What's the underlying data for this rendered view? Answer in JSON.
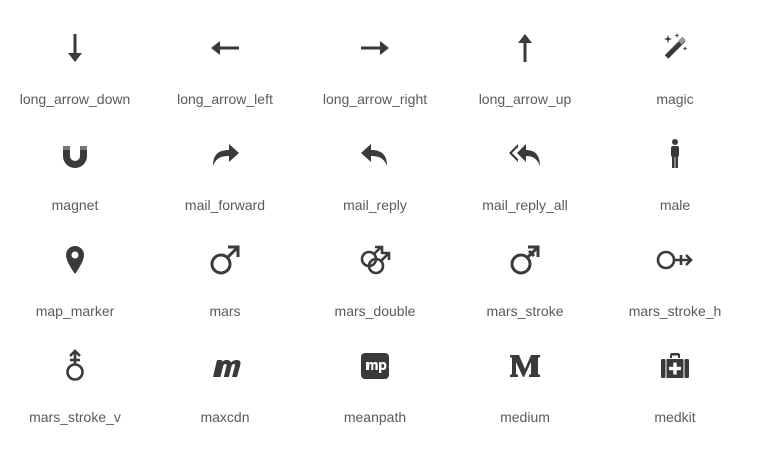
{
  "icons": [
    {
      "label": "long_arrow_down",
      "icon": "long-arrow-down-icon"
    },
    {
      "label": "long_arrow_left",
      "icon": "long-arrow-left-icon"
    },
    {
      "label": "long_arrow_right",
      "icon": "long-arrow-right-icon"
    },
    {
      "label": "long_arrow_up",
      "icon": "long-arrow-up-icon"
    },
    {
      "label": "magic",
      "icon": "magic-wand-icon"
    },
    {
      "label": "magnet",
      "icon": "magnet-icon"
    },
    {
      "label": "mail_forward",
      "icon": "mail-forward-icon"
    },
    {
      "label": "mail_reply",
      "icon": "mail-reply-icon"
    },
    {
      "label": "mail_reply_all",
      "icon": "mail-reply-all-icon"
    },
    {
      "label": "male",
      "icon": "male-icon"
    },
    {
      "label": "map_marker",
      "icon": "map-marker-icon"
    },
    {
      "label": "mars",
      "icon": "mars-icon"
    },
    {
      "label": "mars_double",
      "icon": "mars-double-icon"
    },
    {
      "label": "mars_stroke",
      "icon": "mars-stroke-icon"
    },
    {
      "label": "mars_stroke_h",
      "icon": "mars-stroke-h-icon"
    },
    {
      "label": "mars_stroke_v",
      "icon": "mars-stroke-v-icon"
    },
    {
      "label": "maxcdn",
      "icon": "maxcdn-icon"
    },
    {
      "label": "meanpath",
      "icon": "meanpath-icon"
    },
    {
      "label": "medium",
      "icon": "medium-icon"
    },
    {
      "label": "medkit",
      "icon": "medkit-icon"
    }
  ],
  "colors": {
    "icon": "#3a3a3a",
    "label": "#5a5a5a"
  }
}
